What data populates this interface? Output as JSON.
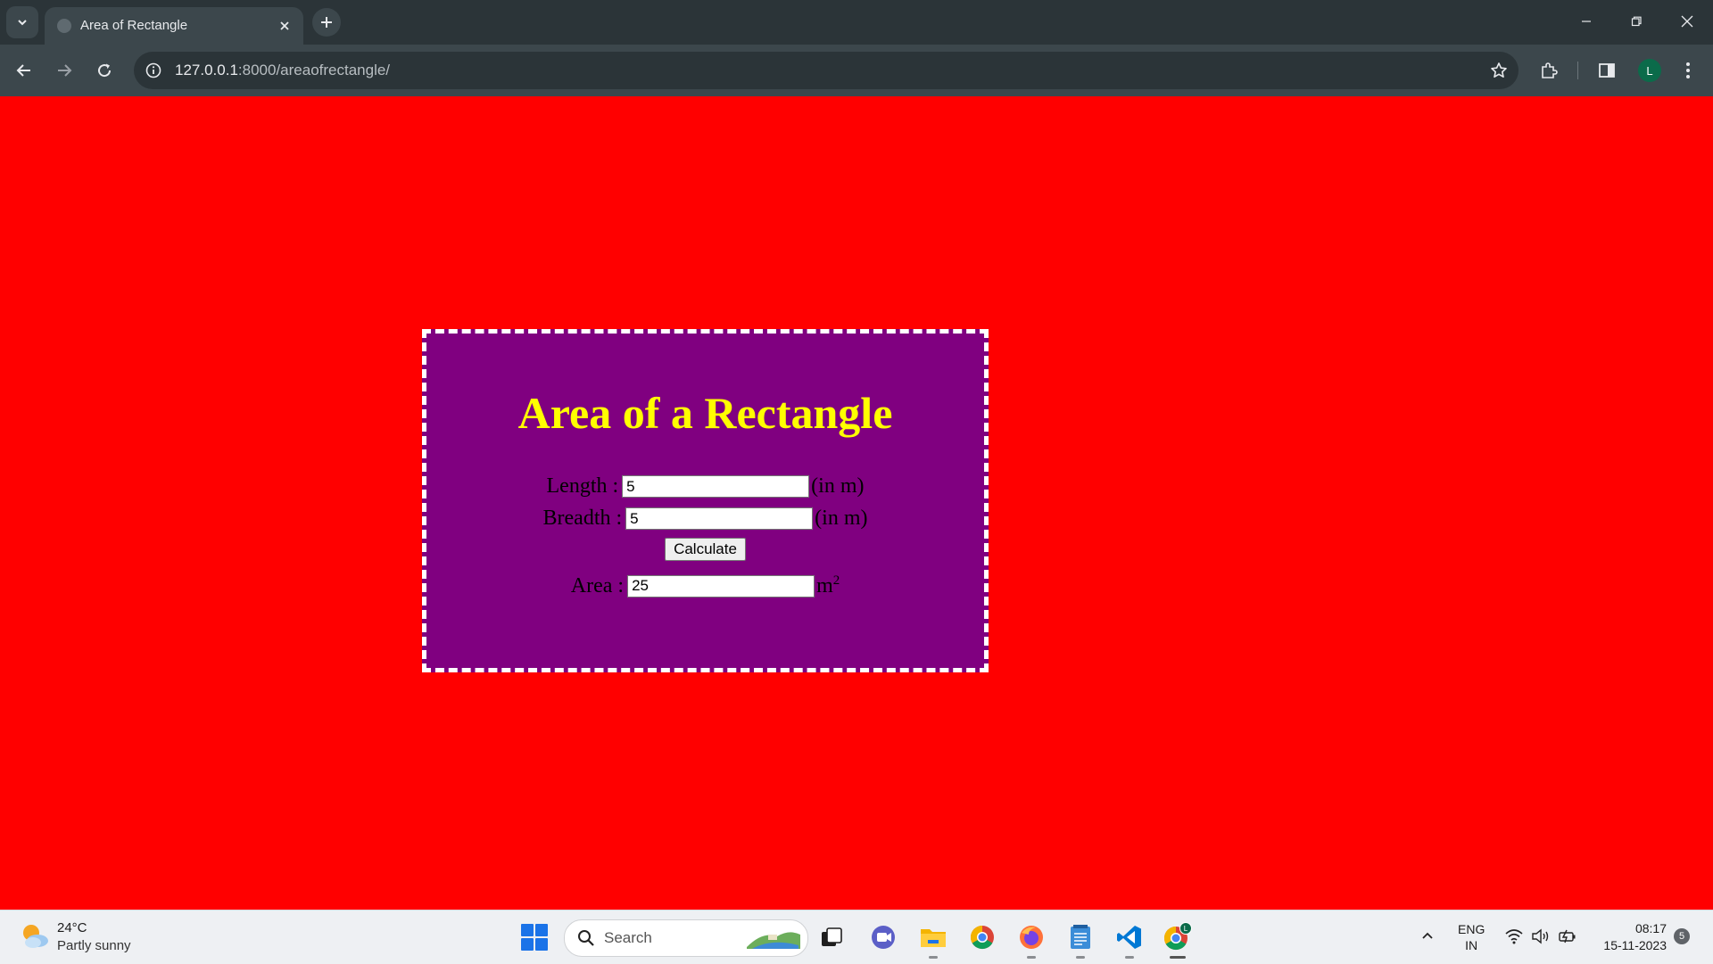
{
  "browser": {
    "tab_title": "Area of Rectangle",
    "url_host": "127.0.0.1",
    "url_path": ":8000/areaofrectangle/",
    "profile_initial": "L"
  },
  "page": {
    "background_color": "#ff0000",
    "card_color": "#800080",
    "heading_color": "#ffff00",
    "heading": "Area of a Rectangle",
    "length_label": "Length :",
    "length_value": "5",
    "length_unit": "(in m)",
    "breadth_label": "Breadth :",
    "breadth_value": "5",
    "breadth_unit": "(in m)",
    "calculate_label": "Calculate",
    "area_label": "Area :",
    "area_value": "25",
    "area_unit": "m",
    "area_unit_exp": "2"
  },
  "taskbar": {
    "weather_temp": "24°C",
    "weather_desc": "Partly sunny",
    "search_placeholder": "Search",
    "language_line1": "ENG",
    "language_line2": "IN",
    "time": "08:17",
    "date": "15-11-2023",
    "notification_count": "5",
    "apps": [
      "task-view",
      "teams-chat",
      "file-explorer",
      "chrome",
      "firefox",
      "notepad",
      "vscode",
      "chrome-profile"
    ]
  }
}
